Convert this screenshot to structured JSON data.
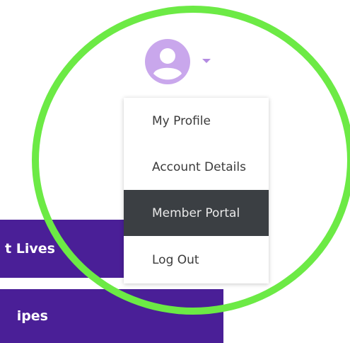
{
  "nav": {
    "items": [
      {
        "label": "t Lives"
      },
      {
        "label": "ipes"
      }
    ]
  },
  "user_menu": {
    "avatar_icon": "user-avatar-icon",
    "caret_icon": "caret-down-icon",
    "items": [
      {
        "label": "My Profile",
        "active": false
      },
      {
        "label": "Account Details",
        "active": false
      },
      {
        "label": "Member Portal",
        "active": true
      },
      {
        "label": "Log Out",
        "active": false
      }
    ]
  },
  "colors": {
    "nav_purple": "#4a1f97",
    "avatar": "#c9a7ec",
    "active_item_bg": "#3b3f43",
    "highlight_ring": "#6cea45"
  }
}
